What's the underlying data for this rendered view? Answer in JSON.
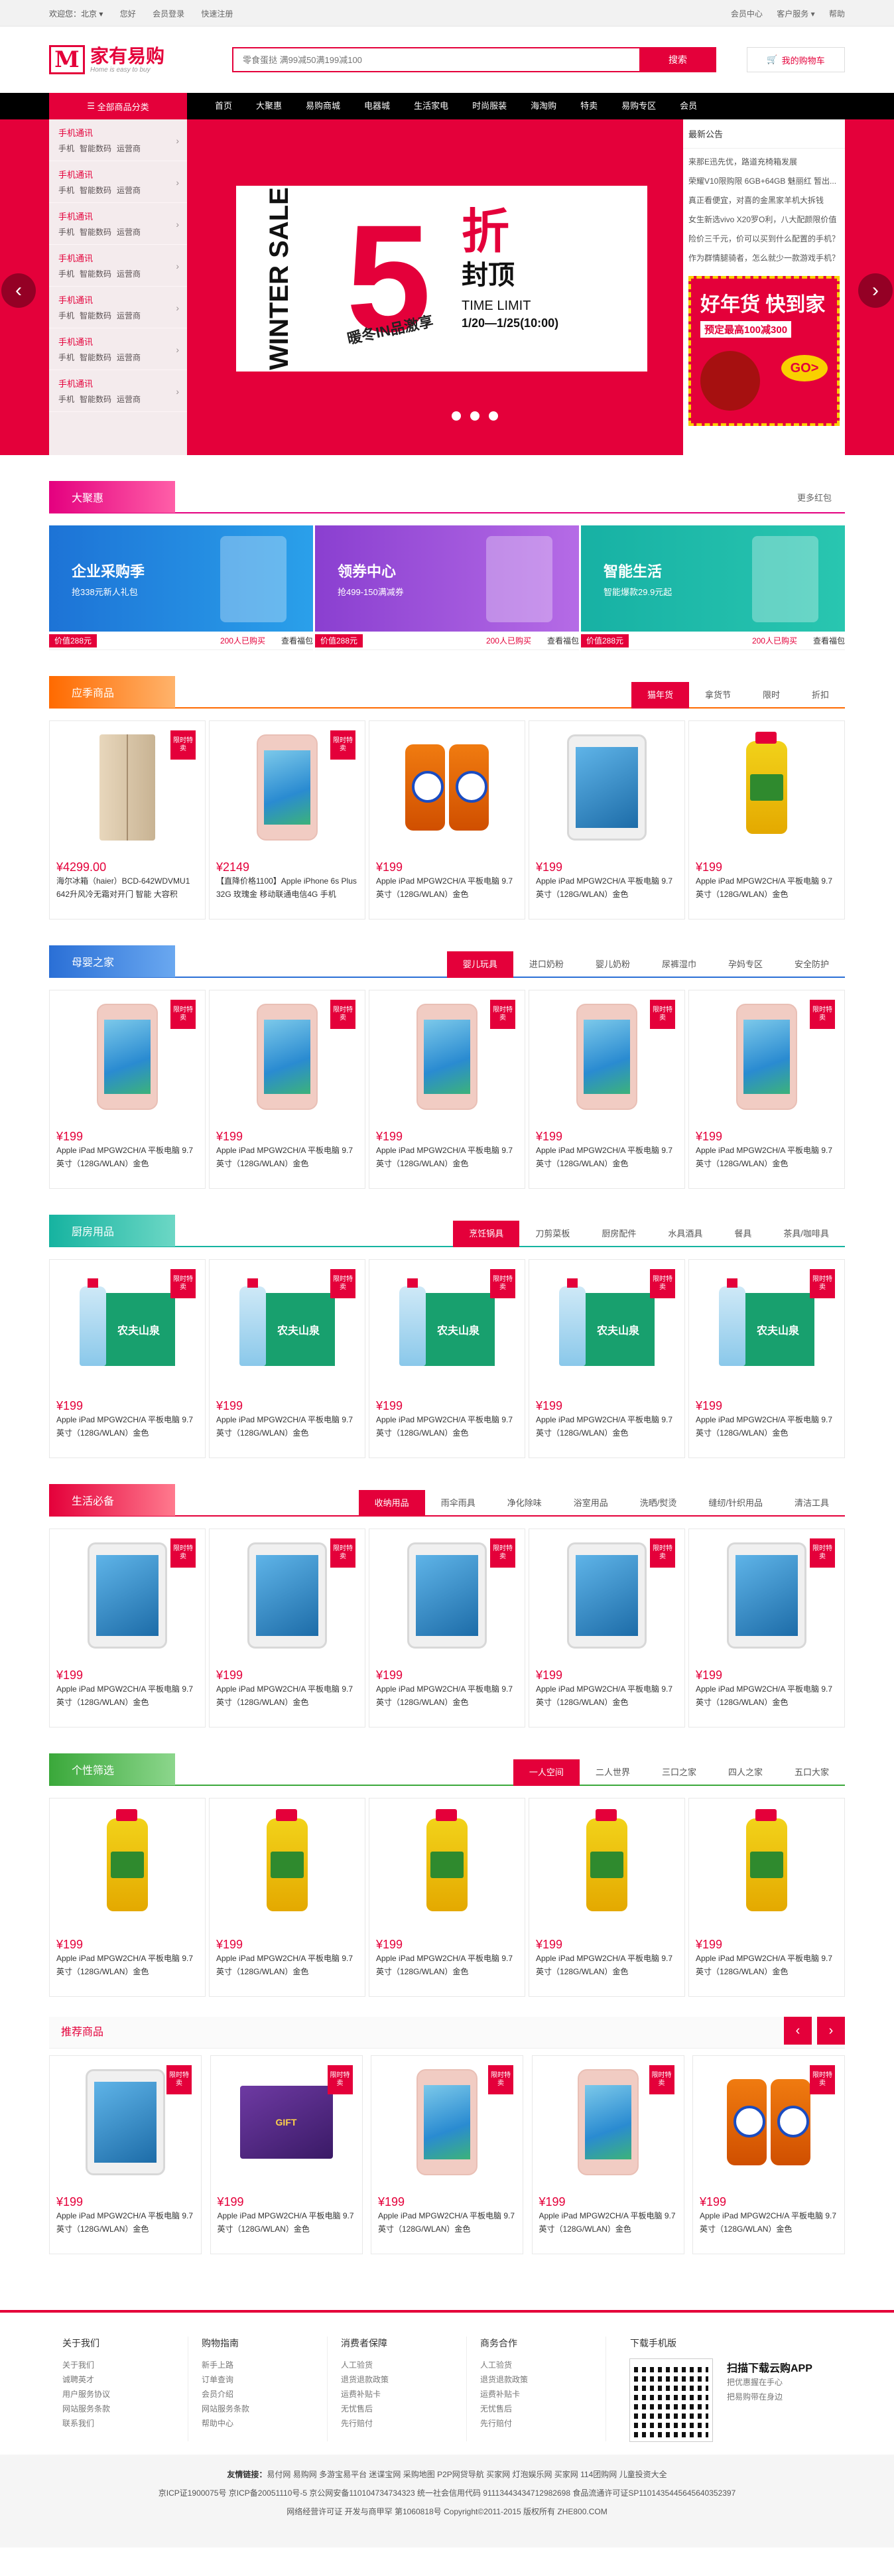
{
  "topbar": {
    "welcome": "欢迎您：北京 ▾",
    "login": "您好",
    "register": "会员登录",
    "quick": "快速注册",
    "right": [
      "会员中心",
      "客户服务 ▾",
      "帮助"
    ]
  },
  "header": {
    "logo_cn": "家有易购",
    "logo_en": "Home is easy to buy",
    "search_placeholder": "零食蛋挞 满99减50满199减100",
    "search_btn": "搜索",
    "cart": "我的购物车"
  },
  "nav": {
    "all": "全部商品分类",
    "items": [
      "首页",
      "大聚惠",
      "易购商城",
      "电器城",
      "生活家电",
      "时尚服装",
      "海淘购",
      "特卖",
      "易购专区",
      "会员"
    ]
  },
  "sidecat": [
    {
      "title": "手机通讯",
      "sub": [
        "手机",
        "智能数码",
        "运营商"
      ]
    },
    {
      "title": "手机通讯",
      "sub": [
        "手机",
        "智能数码",
        "运营商"
      ]
    },
    {
      "title": "手机通讯",
      "sub": [
        "手机",
        "智能数码",
        "运营商"
      ]
    },
    {
      "title": "手机通讯",
      "sub": [
        "手机",
        "智能数码",
        "运营商"
      ]
    },
    {
      "title": "手机通讯",
      "sub": [
        "手机",
        "智能数码",
        "运营商"
      ]
    },
    {
      "title": "手机通讯",
      "sub": [
        "手机",
        "智能数码",
        "运营商"
      ]
    },
    {
      "title": "手机通讯",
      "sub": [
        "手机",
        "智能数码",
        "运营商"
      ]
    }
  ],
  "slide": {
    "winter": "WINTER SALE",
    "five": "5",
    "sub": "暖冬IN品激享",
    "zhe": "折",
    "fengding": "封顶",
    "tl": "TIME LIMIT",
    "date": "1/20—1/25(10:00)"
  },
  "notice": {
    "title": "最新公告",
    "items": [
      "来那E迅先优，路道充椅箱发展",
      "荣耀V10限购限 6GB+64GB 魅丽红 暂出...",
      "真正看便宜，对喜的金黑家羊机大拆钱",
      "女生新选vivo X20罗O利，八大配颜限价值",
      "险价三千元，价可以买到什么配置的手机？",
      "作为群情腿骑者，怎么就少一款游戏手机？"
    ]
  },
  "ad": {
    "title": "好年货 快到家",
    "sub": "预定最高100减300",
    "go": "GO>"
  },
  "juhui": {
    "title": "大聚惠",
    "more": "更多红包",
    "cards": [
      {
        "t": "企业采购季",
        "s": "抢338元新人礼包",
        "price": "价值288元",
        "cnt": "200人已购买",
        "view": "查看福包"
      },
      {
        "t": "领券中心",
        "s": "抢499-150满减券",
        "price": "价值288元",
        "cnt": "200人已购买",
        "view": "查看福包"
      },
      {
        "t": "智能生活",
        "s": "智能爆款29.9元起",
        "price": "价值288元",
        "cnt": "200人已购买",
        "view": "查看福包"
      }
    ]
  },
  "sections": [
    {
      "title": "应季商品",
      "tabs": [
        "猫年货",
        "拿货节",
        "限时",
        "折扣"
      ],
      "items": [
        {
          "img": "fridge",
          "badge": "限时特卖",
          "price": "¥4299.00",
          "name": "海尔冰箱（haier）BCD-642WDVMU1 642升风冷无霜对开门 智能 大容积"
        },
        {
          "img": "phone",
          "badge": "限时特卖",
          "price": "¥2149",
          "name": "【直降价格1100】Apple iPhone 6s Plus 32G 玫瑰金 移动联通电信4G 手机"
        },
        {
          "img": "det",
          "badge": "",
          "price": "¥199",
          "name": "Apple iPad MPGW2CH/A 平板电脑 9.7英寸（128G/WLAN）金色"
        },
        {
          "img": "tab",
          "badge": "",
          "price": "¥199",
          "name": "Apple iPad MPGW2CH/A 平板电脑 9.7英寸（128G/WLAN）金色"
        },
        {
          "img": "oil",
          "badge": "",
          "price": "¥199",
          "name": "Apple iPad MPGW2CH/A 平板电脑 9.7英寸（128G/WLAN）金色"
        }
      ]
    },
    {
      "title": "母婴之家",
      "tabs": [
        "婴儿玩具",
        "进口奶粉",
        "婴儿奶粉",
        "尿裤湿巾",
        "孕妈专区",
        "安全防护"
      ],
      "items": [
        {
          "img": "phone",
          "badge": "限时特卖",
          "price": "¥199",
          "name": "Apple iPad MPGW2CH/A 平板电脑 9.7英寸（128G/WLAN）金色"
        },
        {
          "img": "phone",
          "badge": "限时特卖",
          "price": "¥199",
          "name": "Apple iPad MPGW2CH/A 平板电脑 9.7英寸（128G/WLAN）金色"
        },
        {
          "img": "phone",
          "badge": "限时特卖",
          "price": "¥199",
          "name": "Apple iPad MPGW2CH/A 平板电脑 9.7英寸（128G/WLAN）金色"
        },
        {
          "img": "phone",
          "badge": "限时特卖",
          "price": "¥199",
          "name": "Apple iPad MPGW2CH/A 平板电脑 9.7英寸（128G/WLAN）金色"
        },
        {
          "img": "phone",
          "badge": "限时特卖",
          "price": "¥199",
          "name": "Apple iPad MPGW2CH/A 平板电脑 9.7英寸（128G/WLAN）金色"
        }
      ]
    },
    {
      "title": "厨房用品",
      "tabs": [
        "烹饪锅具",
        "刀剪菜板",
        "厨房配件",
        "水具酒具",
        "餐具",
        "茶具/咖啡具"
      ],
      "items": [
        {
          "img": "water",
          "badge": "限时特卖",
          "price": "¥199",
          "name": "Apple iPad MPGW2CH/A 平板电脑 9.7英寸（128G/WLAN）金色"
        },
        {
          "img": "water",
          "badge": "限时特卖",
          "price": "¥199",
          "name": "Apple iPad MPGW2CH/A 平板电脑 9.7英寸（128G/WLAN）金色"
        },
        {
          "img": "water",
          "badge": "限时特卖",
          "price": "¥199",
          "name": "Apple iPad MPGW2CH/A 平板电脑 9.7英寸（128G/WLAN）金色"
        },
        {
          "img": "water",
          "badge": "限时特卖",
          "price": "¥199",
          "name": "Apple iPad MPGW2CH/A 平板电脑 9.7英寸（128G/WLAN）金色"
        },
        {
          "img": "water",
          "badge": "限时特卖",
          "price": "¥199",
          "name": "Apple iPad MPGW2CH/A 平板电脑 9.7英寸（128G/WLAN）金色"
        }
      ]
    },
    {
      "title": "生活必备",
      "tabs": [
        "收纳用品",
        "雨伞雨具",
        "净化除味",
        "浴室用品",
        "洗晒/熨烫",
        "缝纫/针织用品",
        "清洁工具"
      ],
      "items": [
        {
          "img": "tab",
          "badge": "限时特卖",
          "price": "¥199",
          "name": "Apple iPad MPGW2CH/A 平板电脑 9.7英寸（128G/WLAN）金色"
        },
        {
          "img": "tab",
          "badge": "限时特卖",
          "price": "¥199",
          "name": "Apple iPad MPGW2CH/A 平板电脑 9.7英寸（128G/WLAN）金色"
        },
        {
          "img": "tab",
          "badge": "限时特卖",
          "price": "¥199",
          "name": "Apple iPad MPGW2CH/A 平板电脑 9.7英寸（128G/WLAN）金色"
        },
        {
          "img": "tab",
          "badge": "限时特卖",
          "price": "¥199",
          "name": "Apple iPad MPGW2CH/A 平板电脑 9.7英寸（128G/WLAN）金色"
        },
        {
          "img": "tab",
          "badge": "限时特卖",
          "price": "¥199",
          "name": "Apple iPad MPGW2CH/A 平板电脑 9.7英寸（128G/WLAN）金色"
        }
      ]
    },
    {
      "title": "个性筛选",
      "tabs": [
        "一人空间",
        "二人世界",
        "三口之家",
        "四人之家",
        "五口大家"
      ],
      "items": [
        {
          "img": "oil",
          "badge": "",
          "price": "¥199",
          "name": "Apple iPad MPGW2CH/A 平板电脑 9.7英寸（128G/WLAN）金色"
        },
        {
          "img": "oil",
          "badge": "",
          "price": "¥199",
          "name": "Apple iPad MPGW2CH/A 平板电脑 9.7英寸（128G/WLAN）金色"
        },
        {
          "img": "oil",
          "badge": "",
          "price": "¥199",
          "name": "Apple iPad MPGW2CH/A 平板电脑 9.7英寸（128G/WLAN）金色"
        },
        {
          "img": "oil",
          "badge": "",
          "price": "¥199",
          "name": "Apple iPad MPGW2CH/A 平板电脑 9.7英寸（128G/WLAN）金色"
        },
        {
          "img": "oil",
          "badge": "",
          "price": "¥199",
          "name": "Apple iPad MPGW2CH/A 平板电脑 9.7英寸（128G/WLAN）金色"
        }
      ]
    }
  ],
  "rec": {
    "title": "推荐商品",
    "items": [
      {
        "img": "tab",
        "badge": "限时特卖",
        "price": "¥199",
        "name": "Apple iPad MPGW2CH/A 平板电脑 9.7英寸（128G/WLAN）金色"
      },
      {
        "img": "gift",
        "badge": "限时特卖",
        "price": "¥199",
        "name": "Apple iPad MPGW2CH/A 平板电脑 9.7英寸（128G/WLAN）金色"
      },
      {
        "img": "phone",
        "badge": "限时特卖",
        "price": "¥199",
        "name": "Apple iPad MPGW2CH/A 平板电脑 9.7英寸（128G/WLAN）金色"
      },
      {
        "img": "phone",
        "badge": "限时特卖",
        "price": "¥199",
        "name": "Apple iPad MPGW2CH/A 平板电脑 9.7英寸（128G/WLAN）金色"
      },
      {
        "img": "det",
        "badge": "限时特卖",
        "price": "¥199",
        "name": "Apple iPad MPGW2CH/A 平板电脑 9.7英寸（128G/WLAN）金色"
      }
    ]
  },
  "footer": {
    "cols": [
      {
        "title": "关于我们",
        "links": [
          "关于我们",
          "诚聘英才",
          "用户服务协议",
          "网站服务条款",
          "联系我们"
        ]
      },
      {
        "title": "购物指南",
        "links": [
          "新手上路",
          "订单查询",
          "会员介绍",
          "网站服务条款",
          "帮助中心"
        ]
      },
      {
        "title": "消费者保障",
        "links": [
          "人工验货",
          "退货退款政策",
          "运费补贴卡",
          "无忧售后",
          "先行赔付"
        ]
      },
      {
        "title": "商务合作",
        "links": [
          "人工验货",
          "退货退款政策",
          "运费补贴卡",
          "无忧售后",
          "先行赔付"
        ]
      }
    ],
    "app_title": "下载手机版",
    "app_name": "扫描下载云购APP",
    "app_desc": [
      "把优惠握在手心",
      "把易购带在身边"
    ],
    "links_label": "友情链接：",
    "links": "易付网 易购网 多游宝易平台 迷谍宝网 采购地图 P2P网贷导航 买家网 灯泡娱乐网 买家网 114团购网 儿童投资大全",
    "icp1": "京ICP证1900075号  京ICP备20051110号-5  京公网安备110104734734323  统一社会信用代码 91113443434712982698  食品流通许可证SP1101435445645640352397",
    "icp2": "网络经营许可证  开发与商甲罕 第1060818号  Copyright©2011-2015 版权所有 ZHE800.COM"
  }
}
